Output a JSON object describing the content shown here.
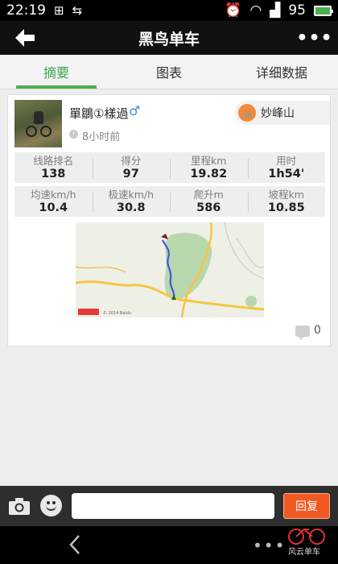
{
  "status_bar": {
    "time": "22:19",
    "battery": "95"
  },
  "header": {
    "title": "黑鸟单车"
  },
  "tabs": [
    {
      "label": "摘要",
      "active": true
    },
    {
      "label": "图表",
      "active": false
    },
    {
      "label": "详细数据",
      "active": false
    }
  ],
  "post": {
    "username": "單鶵①樣過",
    "gender_symbol": "♂",
    "time_ago": "8小时前",
    "place": "妙峰山",
    "comment_count": "0"
  },
  "stats": [
    {
      "label": "线路排名",
      "value": "138"
    },
    {
      "label": "得分",
      "value": "97"
    },
    {
      "label": "里程km",
      "value": "19.82"
    },
    {
      "label": "用时",
      "value": "1h54'"
    },
    {
      "label": "均速km/h",
      "value": "10.4"
    },
    {
      "label": "极速km/h",
      "value": "30.8"
    },
    {
      "label": "爬升m",
      "value": "586"
    },
    {
      "label": "坡程km",
      "value": "10.85"
    }
  ],
  "map": {
    "copyright": "© 2014 Baidu"
  },
  "reply": {
    "placeholder": "",
    "button_label": "回复"
  },
  "watermark": {
    "text": "风云单车"
  },
  "colors": {
    "accent_green": "#4caf50",
    "reply_orange": "#f05a22",
    "route_blue": "#3c57d9"
  }
}
